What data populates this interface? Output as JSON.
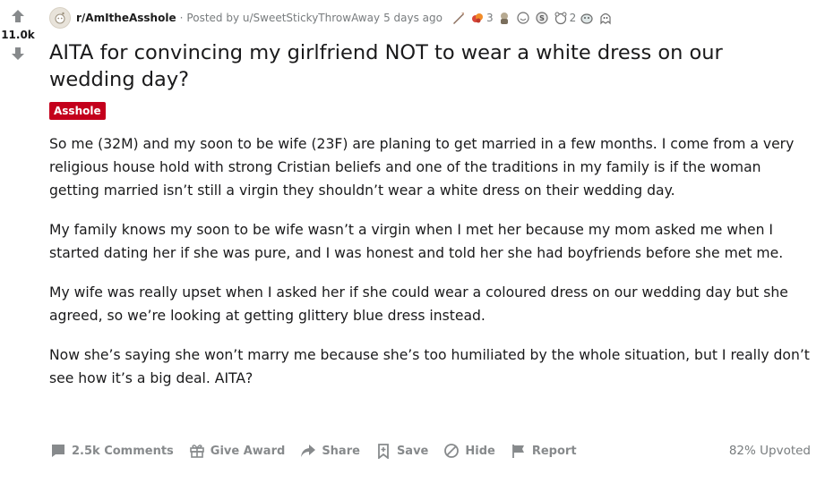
{
  "votes": {
    "count": "11.0k"
  },
  "post": {
    "subreddit": "r/AmItheAsshole",
    "separator": "·",
    "posted_by": "Posted by u/SweetStickyThrowAway",
    "age": "5 days ago",
    "awards": [
      {
        "icon": "silver-award-icon",
        "count": ""
      },
      {
        "icon": "helpful-award-icon",
        "count": "3"
      },
      {
        "icon": "wholesome-award-icon",
        "count": ""
      },
      {
        "icon": "face-award-icon",
        "count": ""
      },
      {
        "icon": "coin-award-icon",
        "count": ""
      },
      {
        "icon": "bear-award-icon",
        "count": "2"
      },
      {
        "icon": "dog-award-icon",
        "count": ""
      },
      {
        "icon": "ghost-award-icon",
        "count": ""
      }
    ],
    "title": "AITA for convincing my girlfriend NOT to wear a white dress on our wedding day?",
    "flair": "Asshole",
    "flair_color": "#c4001c",
    "paragraphs": [
      "So me (32M) and my soon to be wife (23F) are planing to get married in a few months. I come from a very religious house hold with strong Cristian beliefs and one of the traditions in my family is if the woman getting married isn’t still a virgin they shouldn’t wear a white dress on their wedding day.",
      "My family knows my soon to be wife wasn’t a virgin when I met her because my mom asked me when I started dating her if she was pure, and I was honest and told her she had boyfriends before she met me.",
      "My wife was really upset when I asked her if she could wear a coloured dress on our wedding day but she agreed, so we’re looking at getting glittery blue dress instead.",
      "Now she’s saying she won’t marry me because she’s too humiliated by the whole situation, but I really don’t see how it’s a big deal. AITA?"
    ]
  },
  "actions": {
    "comments": "2.5k Comments",
    "award": "Give Award",
    "share": "Share",
    "save": "Save",
    "hide": "Hide",
    "report": "Report",
    "upvoted": "82% Upvoted"
  }
}
